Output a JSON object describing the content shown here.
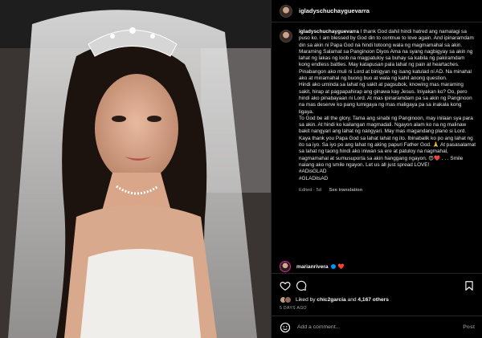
{
  "post": {
    "username": "igladyschuchayguevarra",
    "caption_paragraphs": [
      "I thank God dahil hindi hatred ang namalagi sa puso ko. I am blessed by God din to contnue to love again. And ipinaramdam din sa akin ni Papa God na hindi totoong wala ng magmamahal sa akin. Maraming Salamat sa Panginoon Diyos Ama na syang nagbigyay sa akin ng lahat ng lakas ng loob na magpatuloy sa buhay sa kabila ng pakiramdam kong endless battles. May katapusan pala lahat ng pain at heartaches.",
      "Pinabangon ako muli ni Lord at binigyan ng isang katulad ni AD. Na minahal ako at minamahal ng buong buo at wala ng kahit anong question.",
      "Hindi ako uminda sa lahat ng sakit at pagsubok, knowing mas maraming sakit, hirap at pagpapahirap ang ginawa kay Jesus. Iniyakan ko? Oo, pero hindi ako pinabayaan ni Lord. At mas ipinaramdam pa sa akin ng Panginoon na mas deserve ko pang lumigaya ng mas maligaya pa sa inakala kong ligaya.",
      "To God be all the glory. Tama ang sinabi ng Panginoon, may inilaan sya para sa akin. At hindi ko kailangan magmadali. Ngayon alam ko na ng malinaw bakit nangyari ang lahat ng nangyari. May mas magandang plano si Lord. Kaya thank you Papa God sa lahat lahat ng ito. Ibinabalik ko po ang lahat ng ito sa iyo. Sa iyo po ang lahat ng aking papuri Father God. 🙏 At pasasalamat sa lahat ng taong hindi ako iniwan sa ere at patuloy na nagmahal, nagmamahal at sumusuporta sa akin hanggang ngayon. 😍❤️ . . . Smile nalang ako ng smile ngayon. Let us all just spread LOVE!",
      "#ADisGLAD",
      "#GLADitsAD"
    ],
    "edited_label": "Edited · 5d",
    "see_translation": "See translation",
    "likes_prefix": "Liked by",
    "likes_user": "chic2garcia",
    "likes_and": "and",
    "likes_count": "4,167 others",
    "time_ago": "5 DAYS AGO"
  },
  "comment": {
    "username": "marianrivera",
    "heart": "❤️"
  },
  "add_comment": {
    "placeholder": "Add a comment...",
    "post_label": "Post"
  },
  "icons": [
    "heart-icon",
    "comment-icon",
    "bookmark-icon",
    "emoji-icon",
    "verified-icon"
  ],
  "colors": {
    "background": "#000000",
    "border": "#262626",
    "muted": "#a8a8a8",
    "link_blue": "#0095f6",
    "heart_red": "#ed4956"
  }
}
